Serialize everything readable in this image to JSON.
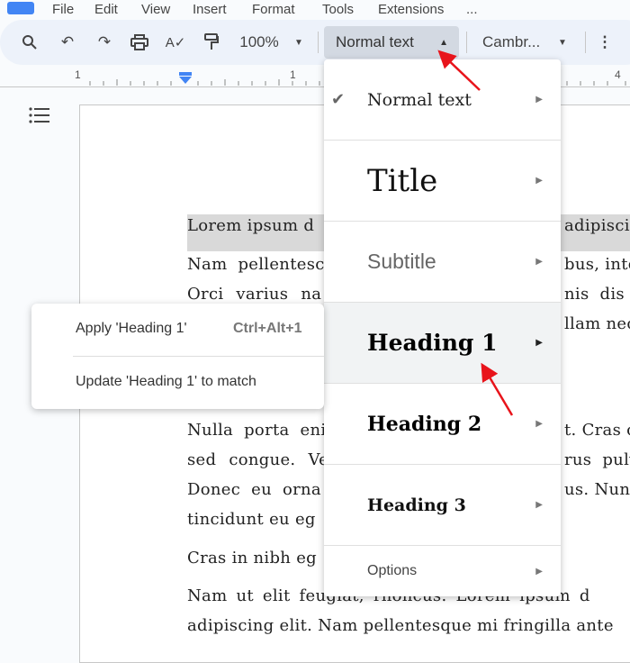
{
  "menubar": {
    "items": [
      "File",
      "Edit",
      "View",
      "Insert",
      "Format",
      "Tools",
      "Extensions",
      "..."
    ]
  },
  "toolbar": {
    "zoom": "100%",
    "style": "Normal text",
    "font": "Cambr..."
  },
  "ruler": {
    "labels": [
      "1",
      "1",
      "4"
    ]
  },
  "document": {
    "lines_left": [
      "Lorem ipsum d",
      "Nam pellentesc",
      "Orci varius na",
      "",
      "Nulla porta eni",
      "sed congue. Ve",
      "Donec eu orna",
      "tincidunt eu eg",
      "Cras in nibh eg"
    ],
    "lines_right": [
      "adipiscin",
      "bus, inte",
      "nis dis p",
      "llam nec",
      "t. Cras c",
      "rus pulv",
      "us. Nunc",
      "",
      ""
    ],
    "line_full_1": "Nam  ut  elit  feugiat,  rhoncus.  Lorem  ipsum  d",
    "line_full_2": "adipiscing elit. Nam pellentesque mi fringilla ante"
  },
  "style_menu": {
    "items": [
      {
        "label": "Normal text",
        "checked": true
      },
      {
        "label": "Title"
      },
      {
        "label": "Subtitle"
      },
      {
        "label": "Heading 1",
        "highlighted": true
      },
      {
        "label": "Heading 2"
      },
      {
        "label": "Heading 3"
      },
      {
        "label": "Options"
      }
    ]
  },
  "submenu": {
    "apply": "Apply 'Heading 1'",
    "shortcut": "Ctrl+Alt+1",
    "update": "Update 'Heading 1' to match"
  },
  "colors": {
    "annotation_arrow": "#e8141b",
    "toolbar_bg": "#edf2fa",
    "ruler_marker": "#4285f4"
  }
}
